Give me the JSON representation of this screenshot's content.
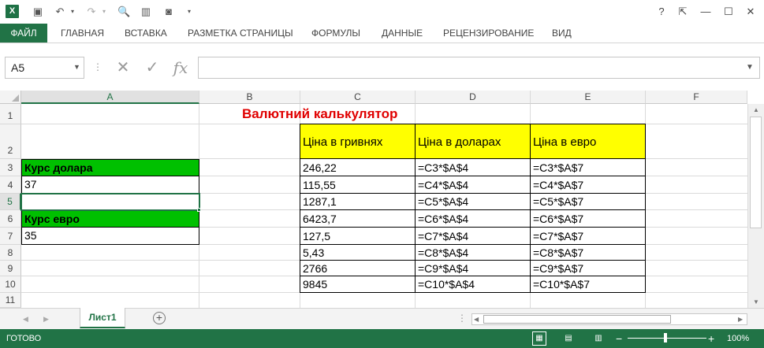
{
  "qat": {
    "app_logo": "X",
    "icons": [
      "excel-icon",
      "save-icon",
      "undo-icon",
      "redo-icon",
      "print-preview-icon",
      "chart-icon",
      "camera-icon",
      "customize-icon"
    ],
    "window_buttons": [
      "?",
      "⇱",
      "—",
      "☐",
      "✕"
    ]
  },
  "ribbon": {
    "file_label": "ФАЙЛ",
    "tabs": [
      "ГЛАВНАЯ",
      "ВСТАВКА",
      "РАЗМЕТКА СТРАНИЦЫ",
      "ФОРМУЛЫ",
      "ДАННЫЕ",
      "РЕЦЕНЗИРОВАНИЕ",
      "ВИД"
    ]
  },
  "formula_bar": {
    "name_box": "A5",
    "cancel_symbol": "✕",
    "enter_symbol": "✓",
    "fx_symbol": "fx",
    "value": ""
  },
  "grid": {
    "columns": [
      "A",
      "B",
      "C",
      "D",
      "E",
      "F"
    ],
    "selected_column": "A",
    "rows": [
      "1",
      "2",
      "3",
      "4",
      "5",
      "6",
      "7",
      "8",
      "9",
      "10",
      "11"
    ],
    "selected_row": "5",
    "title": "Валютний калькулятор",
    "A3": "Курс долара",
    "A4": "37",
    "A6": "Курс евро",
    "A7": "35",
    "headers": {
      "C": "Ціна в гривнях",
      "D": "Ціна в доларах",
      "E": "Ціна в евро"
    },
    "table": [
      [
        "246,22",
        "=C3*$A$4",
        "=C3*$A$7"
      ],
      [
        "115,55",
        "=C4*$A$4",
        "=C4*$A$7"
      ],
      [
        "1287,1",
        "=C5*$A$4",
        "=C5*$A$7"
      ],
      [
        "6423,7",
        "=C6*$A$4",
        "=C6*$A$7"
      ],
      [
        "127,5",
        "=C7*$A$4",
        "=C7*$A$7"
      ],
      [
        "5,43",
        "=C8*$A$4",
        "=C8*$A$7"
      ],
      [
        "2766",
        "=C9*$A$4",
        "=C9*$A$7"
      ],
      [
        "9845",
        "=C10*$A$4",
        "=C10*$A$7"
      ]
    ]
  },
  "sheets": {
    "active": "Лист1",
    "add_symbol": "+"
  },
  "status": {
    "ready": "ГОТОВО",
    "zoom": "100%",
    "zoom_minus": "−",
    "zoom_plus": "+"
  },
  "colors": {
    "excel_green": "#217346",
    "label_fill": "#00c000",
    "header_fill": "#ffff00",
    "title_red": "#e00000"
  }
}
